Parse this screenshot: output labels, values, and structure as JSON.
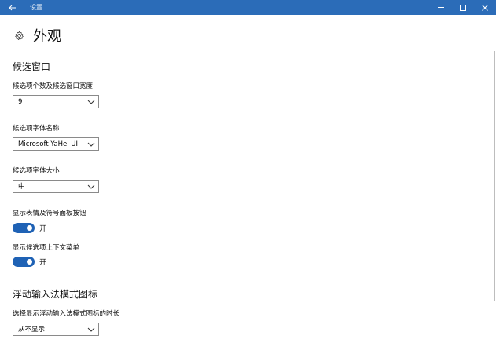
{
  "window": {
    "title": "设置",
    "back_icon": "back-arrow-icon",
    "controls": {
      "minimize": "minimize-icon",
      "maximize": "maximize-icon",
      "close": "close-icon"
    },
    "titlebar_color": "#2b6cb8"
  },
  "page": {
    "title": "外观",
    "icon": "gear-icon"
  },
  "candidate_window": {
    "heading": "候选窗口",
    "count_label": "候选项个数及候选窗口宽度",
    "count_value": "9",
    "font_name_label": "候选项字体名称",
    "font_name_value": "Microsoft YaHei UI",
    "font_size_label": "候选项字体大小",
    "font_size_value": "中",
    "emoji_label": "显示表情及符号面板按钮",
    "emoji_state": "开",
    "context_menu_label": "显示候选项上下文菜单",
    "context_menu_state": "开",
    "toggle_color": "#1f62b5"
  },
  "floating_icon": {
    "heading": "浮动输入法模式图标",
    "duration_label": "选择显示浮动输入法模式图标的时长",
    "duration_value": "从不显示"
  }
}
